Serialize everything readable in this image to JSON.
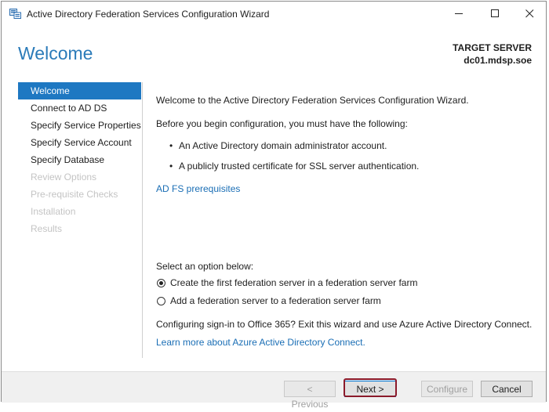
{
  "window": {
    "title": "Active Directory Federation Services Configuration Wizard",
    "icon": "adfs-server-icon",
    "controls": [
      "minimize-icon",
      "maximize-icon",
      "close-icon"
    ]
  },
  "header": {
    "title": "Welcome",
    "target_label": "TARGET SERVER",
    "target_name": "dc01.mdsp.soe"
  },
  "nav": {
    "items": [
      {
        "label": "Welcome",
        "state": "active"
      },
      {
        "label": "Connect to AD DS",
        "state": "enabled"
      },
      {
        "label": "Specify Service Properties",
        "state": "enabled"
      },
      {
        "label": "Specify Service Account",
        "state": "enabled"
      },
      {
        "label": "Specify Database",
        "state": "enabled"
      },
      {
        "label": "Review Options",
        "state": "disabled"
      },
      {
        "label": "Pre-requisite Checks",
        "state": "disabled"
      },
      {
        "label": "Installation",
        "state": "disabled"
      },
      {
        "label": "Results",
        "state": "disabled"
      }
    ]
  },
  "content": {
    "intro": "Welcome to the Active Directory Federation Services Configuration Wizard.",
    "prereq_heading": "Before you begin configuration, you must have the following:",
    "bullets": [
      "An Active Directory domain administrator account.",
      "A publicly trusted certificate for SSL server authentication."
    ],
    "prereq_link": "AD FS prerequisites",
    "option_heading": "Select an option below:",
    "options": [
      {
        "label": "Create the first federation server in a federation server farm",
        "checked": true
      },
      {
        "label": "Add a federation server to a federation server farm",
        "checked": false
      }
    ],
    "office_text": "Configuring sign-in to Office 365? Exit this wizard and use Azure Active Directory Connect.",
    "office_link": "Learn more about Azure Active Directory Connect."
  },
  "footer": {
    "previous": "< Previous",
    "next": "Next >",
    "configure": "Configure",
    "cancel": "Cancel"
  },
  "colors": {
    "accent": "#1e78c2",
    "title": "#2b7bb9",
    "link": "#1a6eb5",
    "highlight": "#8b1a2b"
  }
}
